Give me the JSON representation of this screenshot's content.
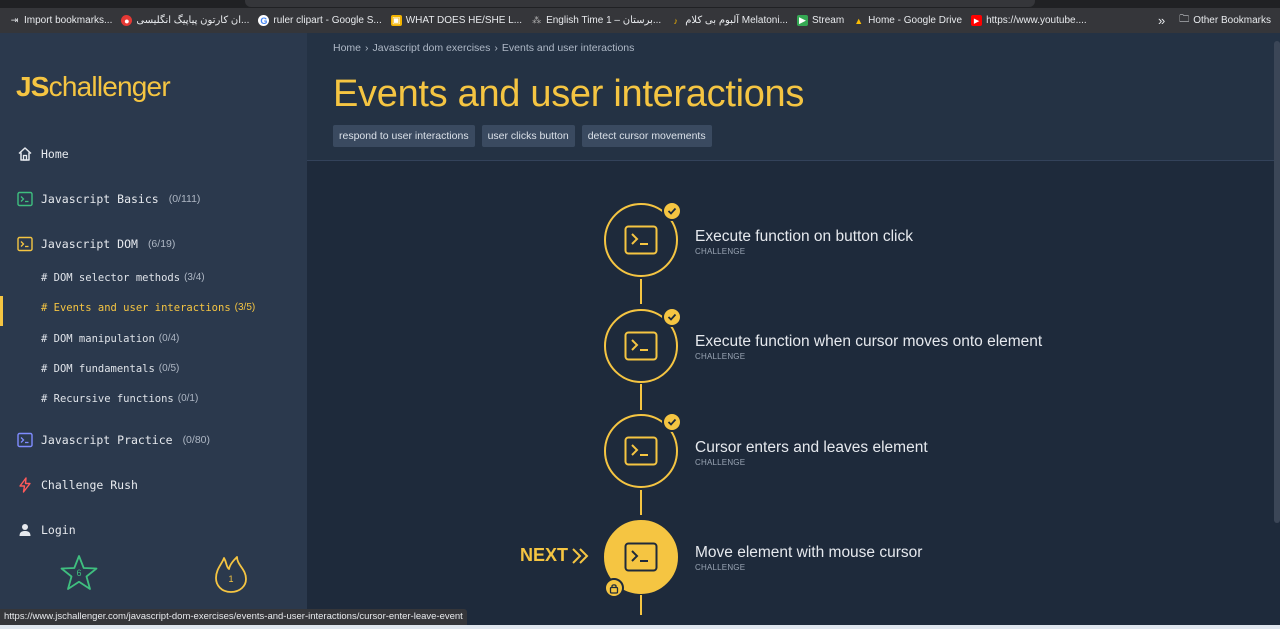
{
  "bookmarks": [
    {
      "icon": "import-icon",
      "label": "Import bookmarks..."
    },
    {
      "icon": "red-circle-icon",
      "label": "ان کارتون پیاپیگ انگلیسی..."
    },
    {
      "icon": "google-icon",
      "label": "ruler clipart - Google S..."
    },
    {
      "icon": "yellow-square-icon",
      "label": "WHAT DOES HE/SHE L..."
    },
    {
      "icon": "ribbon-icon",
      "label": "English Time 1 – برستان..."
    },
    {
      "icon": "audio-icon",
      "label": "آلبوم بی کلام Melatoni..."
    },
    {
      "icon": "stream-icon",
      "label": "Stream"
    },
    {
      "icon": "drive-icon",
      "label": "Home - Google Drive"
    },
    {
      "icon": "youtube-icon",
      "label": "https://www.youtube...."
    }
  ],
  "other_bookmarks": "Other Bookmarks",
  "logo": {
    "bold": "JS",
    "rest": "challenger"
  },
  "sidebar": {
    "home": "Home",
    "basics": {
      "label": "Javascript Basics",
      "count": "(0/111)"
    },
    "dom": {
      "label": "Javascript DOM",
      "count": "(6/19)"
    },
    "sub": [
      {
        "label": "# DOM selector methods",
        "count": "(3/4)"
      },
      {
        "label": "# Events and user interactions",
        "count": "(3/5)"
      },
      {
        "label": "# DOM manipulation",
        "count": "(0/4)"
      },
      {
        "label": "# DOM fundamentals",
        "count": "(0/5)"
      },
      {
        "label": "# Recursive functions",
        "count": "(0/1)"
      }
    ],
    "practice": {
      "label": "Javascript Practice",
      "count": "(0/80)"
    },
    "rush": "Challenge Rush",
    "login": "Login",
    "star_count": "6",
    "fire_count": "1"
  },
  "breadcrumb": {
    "home": "Home",
    "section": "Javascript dom exercises",
    "current": "Events and user interactions"
  },
  "page_title": "Events and user interactions",
  "tags": [
    "respond to user interactions",
    "user clicks button",
    "detect cursor movements"
  ],
  "challenges": [
    {
      "title": "Execute function on button click",
      "type": "CHALLENGE",
      "status": "done"
    },
    {
      "title": "Execute function when cursor moves onto element",
      "type": "CHALLENGE",
      "status": "done"
    },
    {
      "title": "Cursor enters and leaves element",
      "type": "CHALLENGE",
      "status": "done"
    },
    {
      "title": "Move element with mouse cursor",
      "type": "CHALLENGE",
      "status": "next"
    }
  ],
  "next_label": "NEXT",
  "status_url": "https://www.jschallenger.com/javascript-dom-exercises/events-and-user-interactions/cursor-enter-leave-event",
  "colors": {
    "accent": "#f5c542",
    "sidebar": "#2b394d",
    "main": "#1e2a3b",
    "basics_icon": "#3fbf7f",
    "practice_icon": "#7f8cff",
    "rush_icon": "#ff5a5a",
    "star": "#3fbf7f"
  }
}
